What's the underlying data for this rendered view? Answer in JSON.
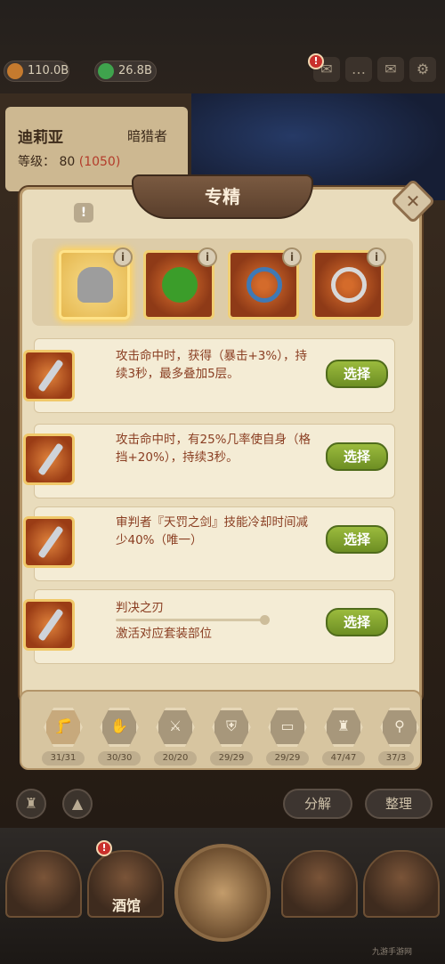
{
  "resources": [
    {
      "value": "110.0B",
      "color": "#c57a2e",
      "icon": "gold-coin-icon"
    },
    {
      "value": "26.8B",
      "color": "#3fa34d",
      "icon": "green-gem-icon"
    }
  ],
  "top_icons": [
    "mail-alert-icon",
    "chat-icon",
    "mail-icon",
    "gear-icon"
  ],
  "hero": {
    "name": "迪莉亚",
    "class": "暗猎者",
    "level_label": "等级：",
    "level": "80",
    "level_extra": "(1050)"
  },
  "modal": {
    "title": "专精",
    "close_glyph": "✕",
    "info_glyph": "!",
    "badge_glyph": "i",
    "slots": [
      {
        "name": "helmet",
        "color": "#9d9d9d",
        "selected": true
      },
      {
        "name": "green-potion",
        "color": "#3b9d2a",
        "selected": false
      },
      {
        "name": "blue-ring",
        "color": "#3f79b5",
        "selected": false
      },
      {
        "name": "silver-ring",
        "color": "#d8d8d8",
        "selected": false
      }
    ],
    "options": [
      {
        "text": "攻击命中时，获得（暴击+3%），持续3秒，最多叠加5层。",
        "button": "选择"
      },
      {
        "text": "攻击命中时，有25%几率使自身（格挡+20%），持续3秒。",
        "button": "选择"
      },
      {
        "text": "审判者『天罚之剑』技能冷却时间减少40%（唯一）",
        "button": "选择"
      },
      {
        "text": "判决之刃",
        "subtext": "激活对应套装部位",
        "button": "选择"
      }
    ]
  },
  "categories": [
    {
      "icon": "leg-icon",
      "count": "31/31"
    },
    {
      "icon": "glove-icon",
      "count": "30/30"
    },
    {
      "icon": "sword-icon",
      "count": "20/20"
    },
    {
      "icon": "shield-icon",
      "count": "29/29"
    },
    {
      "icon": "book-icon",
      "count": "29/29"
    },
    {
      "icon": "armor-icon",
      "count": "47/47"
    },
    {
      "icon": "magnifier-icon",
      "count": "37/3"
    }
  ],
  "actions": {
    "decompose": "分解",
    "sort": "整理"
  },
  "nav": {
    "tavern_label": "酒馆"
  },
  "watermark": "九游手游网"
}
